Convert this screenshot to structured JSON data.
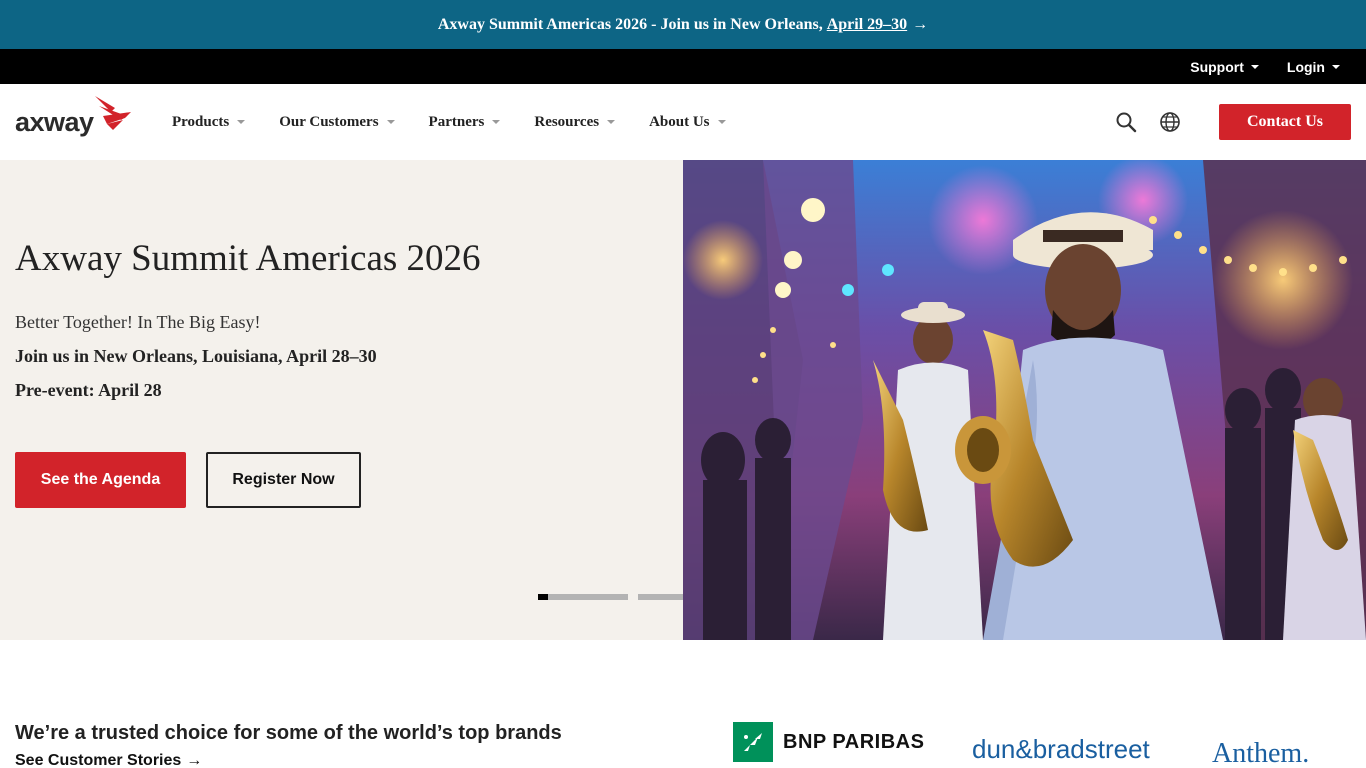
{
  "announcement": {
    "text": "Axway Summit Americas 2026 - Join us in New Orleans,",
    "link_text": "April 29–30",
    "arrow": "→"
  },
  "utility_nav": {
    "items": [
      {
        "label": "Support"
      },
      {
        "label": "Login"
      }
    ]
  },
  "brand": {
    "logo_text": "axway",
    "accent_color": "#d2232a"
  },
  "main_nav": {
    "items": [
      {
        "label": "Products"
      },
      {
        "label": "Our Customers"
      },
      {
        "label": "Partners"
      },
      {
        "label": "Resources"
      },
      {
        "label": "About Us"
      }
    ],
    "search_icon": "search-icon",
    "language_icon": "globe-icon",
    "contact_label": "Contact Us"
  },
  "hero": {
    "title": "Axway Summit Americas 2026",
    "subtitle": "Better Together! In The Big Easy!",
    "line2": "Join us in New Orleans, Louisiana, April 28–30",
    "line3": "Pre-event: April 28",
    "primary_button": "See the Agenda",
    "secondary_button": "Register Now",
    "carousel_slides": 3,
    "active_slide": 1
  },
  "brands": {
    "title": "We’re a trusted choice for some of the world’s top brands",
    "link": "See Customer Stories",
    "arrow": "→",
    "logos": [
      {
        "name": "BNP PARIBAS"
      },
      {
        "name": "dun&bradstreet"
      },
      {
        "name": "Anthem."
      }
    ]
  },
  "colors": {
    "announcement_bg": "#0d6585",
    "utility_bg": "#000000",
    "hero_bg": "#f4f1ec",
    "primary_red": "#d2232a"
  }
}
